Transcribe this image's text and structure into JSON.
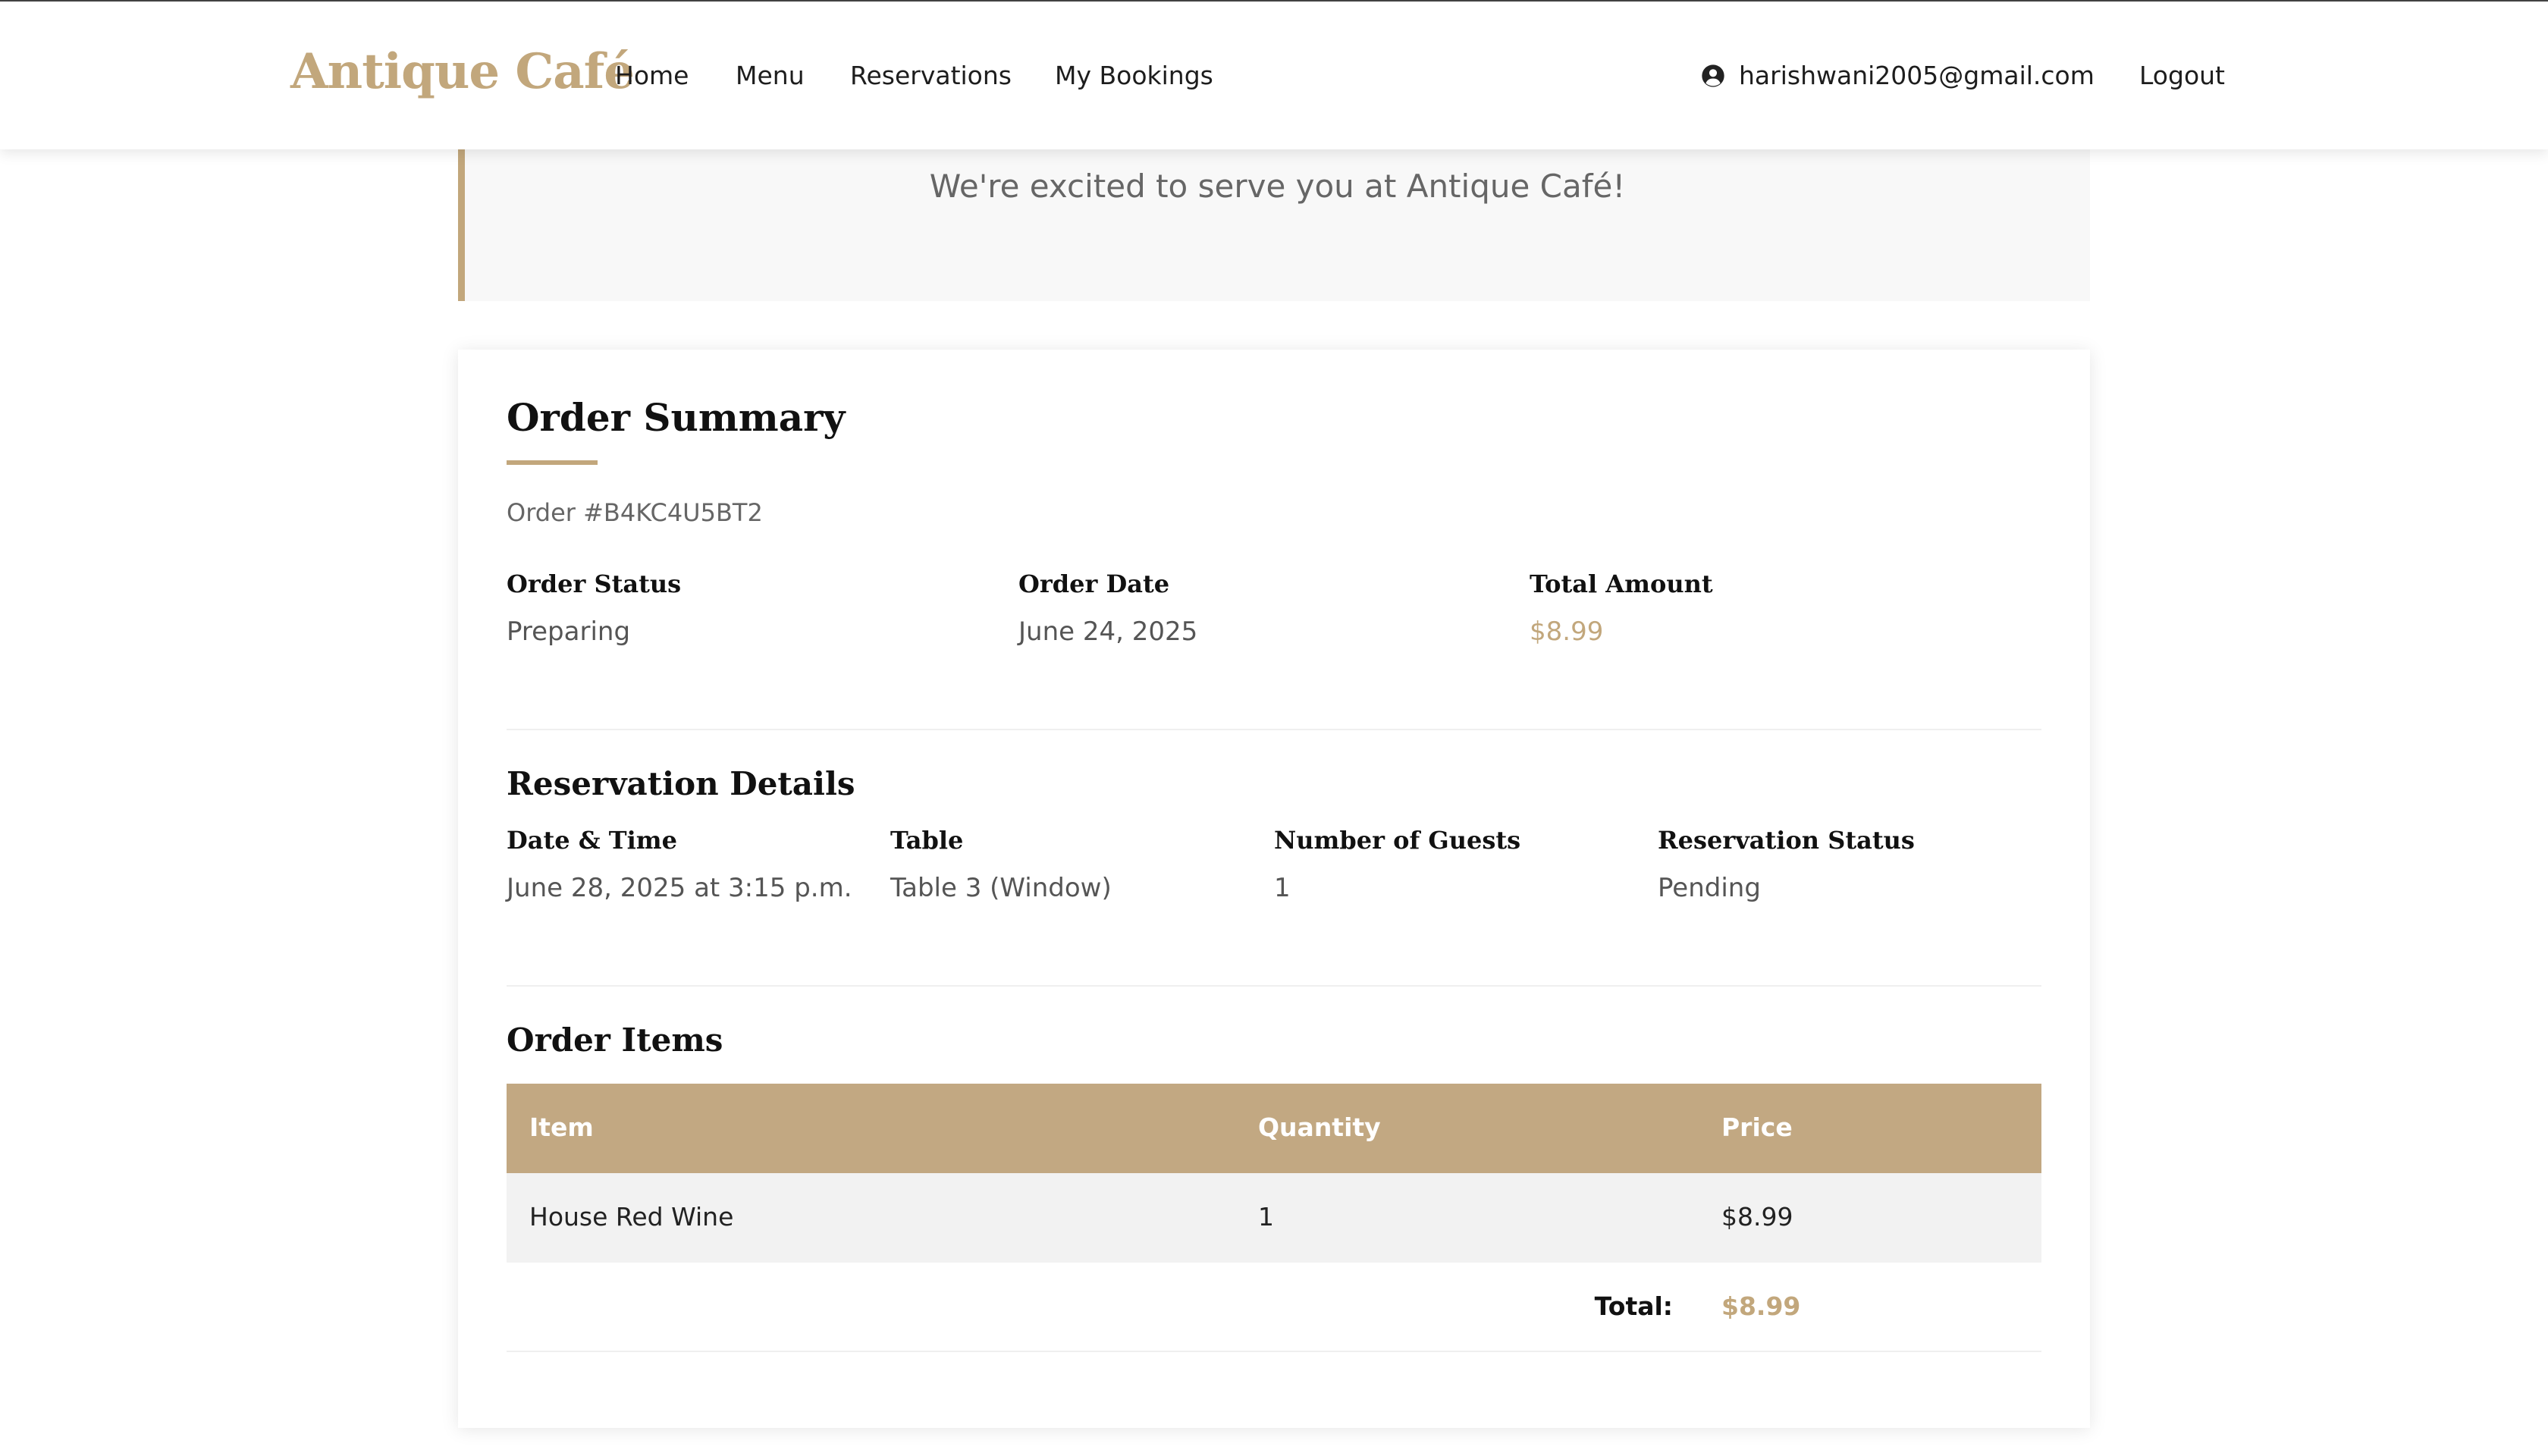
{
  "nav": {
    "brand": "Antique Café",
    "links": [
      "Home",
      "Menu",
      "Reservations",
      "My Bookings"
    ],
    "user_email": "harishwani2005@gmail.com",
    "logout": "Logout"
  },
  "banner": {
    "message": "We're excited to serve you at Antique Café!"
  },
  "summary": {
    "title": "Order Summary",
    "order_number": "Order #B4KC4U5BT2",
    "fields": [
      {
        "label": "Order Status",
        "value": "Preparing"
      },
      {
        "label": "Order Date",
        "value": "June 24, 2025"
      },
      {
        "label": "Total Amount",
        "value": "$8.99"
      }
    ]
  },
  "reservation": {
    "title": "Reservation Details",
    "fields": [
      {
        "label": "Date & Time",
        "value": "June 28, 2025 at 3:15 p.m."
      },
      {
        "label": "Table",
        "value": "Table 3 (Window)"
      },
      {
        "label": "Number of Guests",
        "value": "1"
      },
      {
        "label": "Reservation Status",
        "value": "Pending"
      }
    ]
  },
  "items": {
    "title": "Order Items",
    "columns": [
      "Item",
      "Quantity",
      "Price"
    ],
    "rows": [
      {
        "item": "House Red Wine",
        "quantity": "1",
        "price": "$8.99"
      }
    ],
    "total_label": "Total:",
    "total_value": "$8.99"
  },
  "colors": {
    "accent": "#c2a77c",
    "table_header": "#c2a882"
  },
  "icons": {
    "user": "user-circle-icon"
  }
}
